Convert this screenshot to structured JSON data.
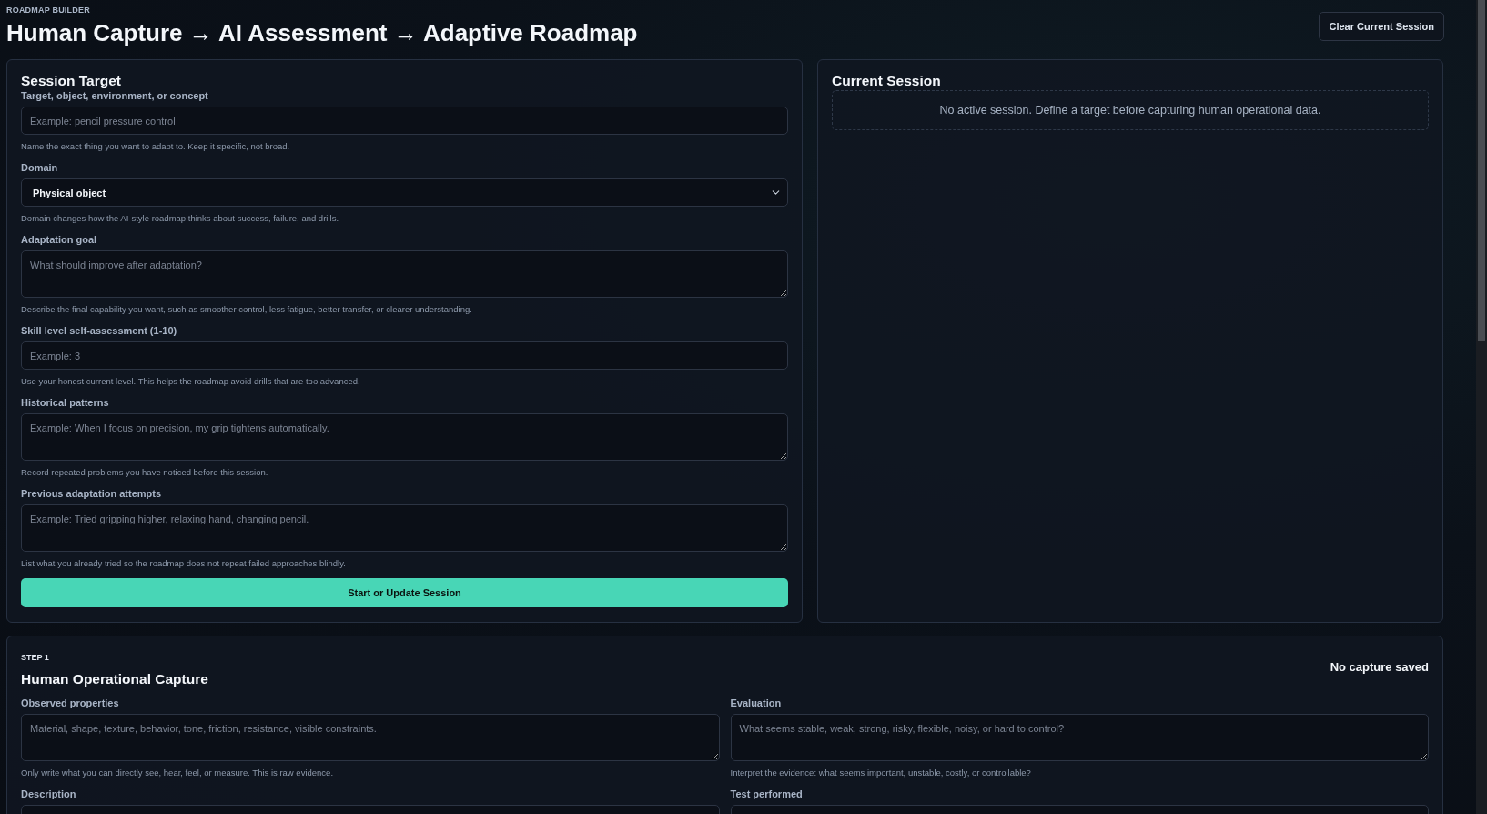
{
  "header": {
    "eyebrow": "ROADMAP BUILDER",
    "title": "Human Capture → AI Assessment → Adaptive Roadmap",
    "clear_button": "Clear Current Session"
  },
  "session_target": {
    "title": "Session Target",
    "fields": [
      {
        "kind": "input",
        "label": "Target, object, environment, or concept",
        "placeholder": "Example: pencil pressure control",
        "help": "Name the exact thing you want to adapt to. Keep it specific, not broad."
      },
      {
        "kind": "select",
        "label": "Domain",
        "value": "Physical object",
        "help": "Domain changes how the AI-style roadmap thinks about success, failure, and drills."
      },
      {
        "kind": "textarea",
        "label": "Adaptation goal",
        "placeholder": "What should improve after adaptation?",
        "help": "Describe the final capability you want, such as smoother control, less fatigue, better transfer, or clearer understanding."
      },
      {
        "kind": "input",
        "label": "Skill level self-assessment (1-10)",
        "placeholder": "Example: 3",
        "help": "Use your honest current level. This helps the roadmap avoid drills that are too advanced."
      },
      {
        "kind": "textarea",
        "label": "Historical patterns",
        "placeholder": "Example: When I focus on precision, my grip tightens automatically.",
        "help": "Record repeated problems you have noticed before this session."
      },
      {
        "kind": "textarea",
        "label": "Previous adaptation attempts",
        "placeholder": "Example: Tried gripping higher, relaxing hand, changing pencil.",
        "help": "List what you already tried so the roadmap does not repeat failed approaches blindly."
      }
    ],
    "submit_button": "Start or Update Session"
  },
  "current_session": {
    "title": "Current Session",
    "empty_message": "No active session. Define a target before capturing human operational data."
  },
  "capture": {
    "step": "STEP 1",
    "title": "Human Operational Capture",
    "status": "No capture saved",
    "fields": [
      {
        "kind": "textarea",
        "label": "Observed properties",
        "placeholder": "Material, shape, texture, behavior, tone, friction, resistance, visible constraints.",
        "help": "Only write what you can directly see, hear, feel, or measure. This is raw evidence."
      },
      {
        "kind": "textarea",
        "label": "Evaluation",
        "placeholder": "What seems stable, weak, strong, risky, flexible, noisy, or hard to control?",
        "help": "Interpret the evidence: what seems important, unstable, costly, or controllable?"
      },
      {
        "kind": "textarea",
        "label": "Description"
      },
      {
        "kind": "textarea",
        "label": "Test performed"
      }
    ]
  }
}
